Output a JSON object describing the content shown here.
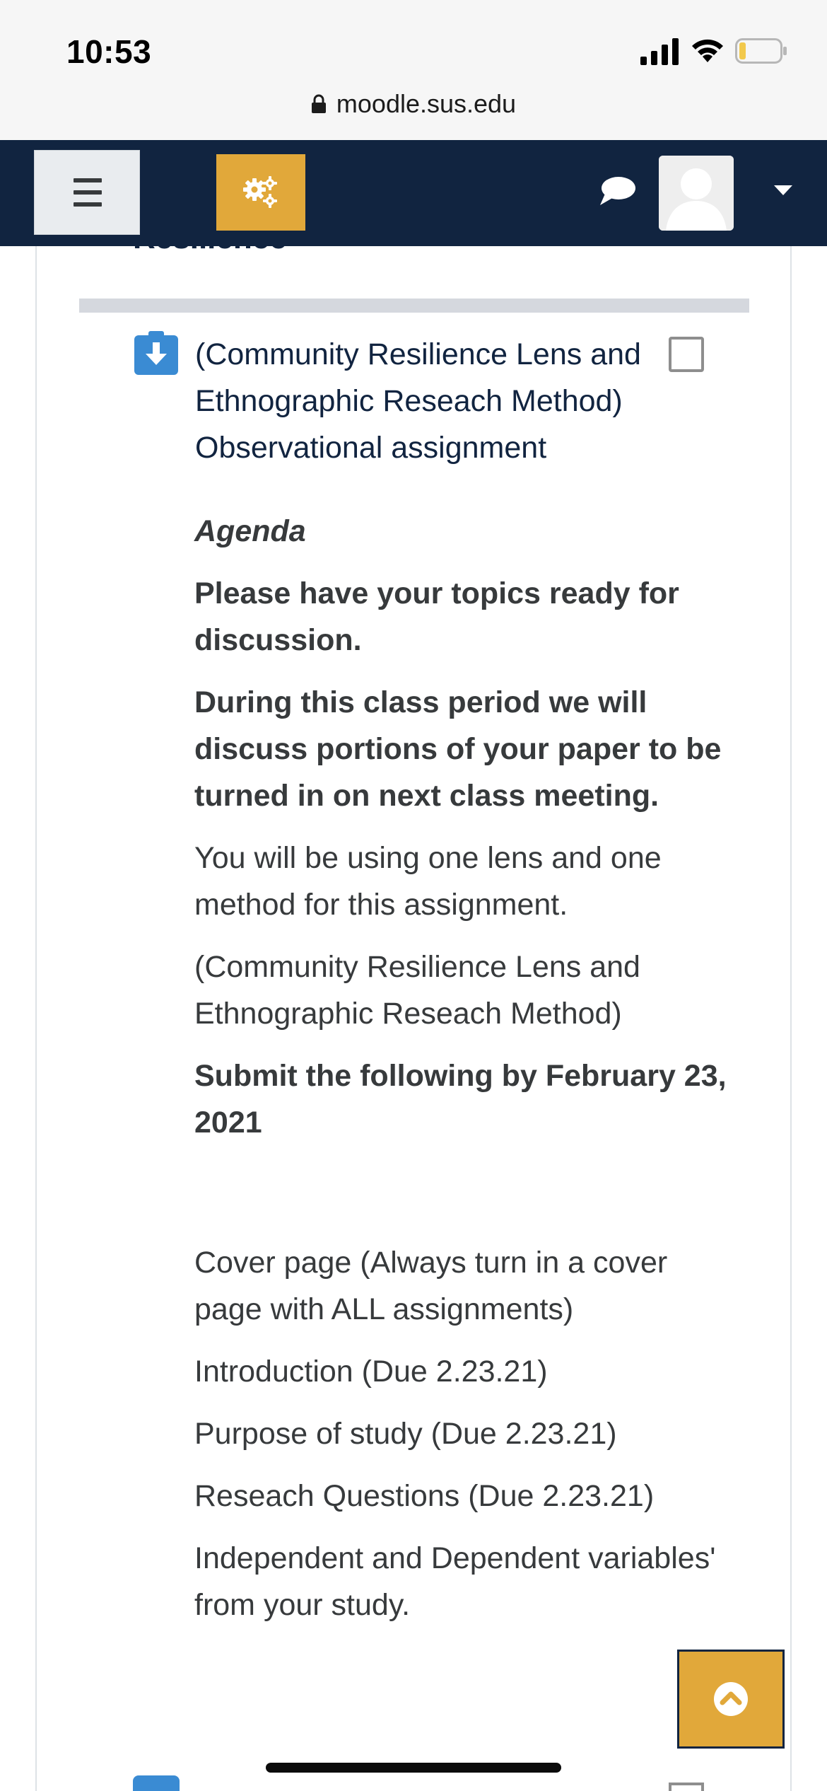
{
  "status_bar": {
    "time": "10:53",
    "url": "moodle.sus.edu"
  },
  "navbar": {
    "brand_color": "#112440",
    "accent_color": "#e1a83a"
  },
  "section": {
    "partial_title": "Resilience"
  },
  "activity": {
    "icon": "assignment-download-icon",
    "title": "(Community Resilience Lens and Ethnographic Reseach Method) Observational assignment",
    "completion": "unchecked"
  },
  "description": {
    "agenda_heading": "Agenda",
    "para_topics": "Please have your topics ready for discussion.",
    "para_class_period": "During this class period we will discuss portions of your paper to be turned in on next class meeting.",
    "para_lens_method": "You will be using one lens and one method for this assignment.",
    "para_lens_names": "(Community Resilience Lens and Ethnographic Reseach Method)",
    "para_submit": "Submit the following by February 23, 2021",
    "items": [
      "Cover page (Always turn in a cover page with ALL assignments)",
      "Introduction (Due 2.23.21)",
      "Purpose of study (Due 2.23.21)",
      "Reseach Questions (Due 2.23.21)",
      "Independent and Dependent variables' from your study."
    ]
  }
}
